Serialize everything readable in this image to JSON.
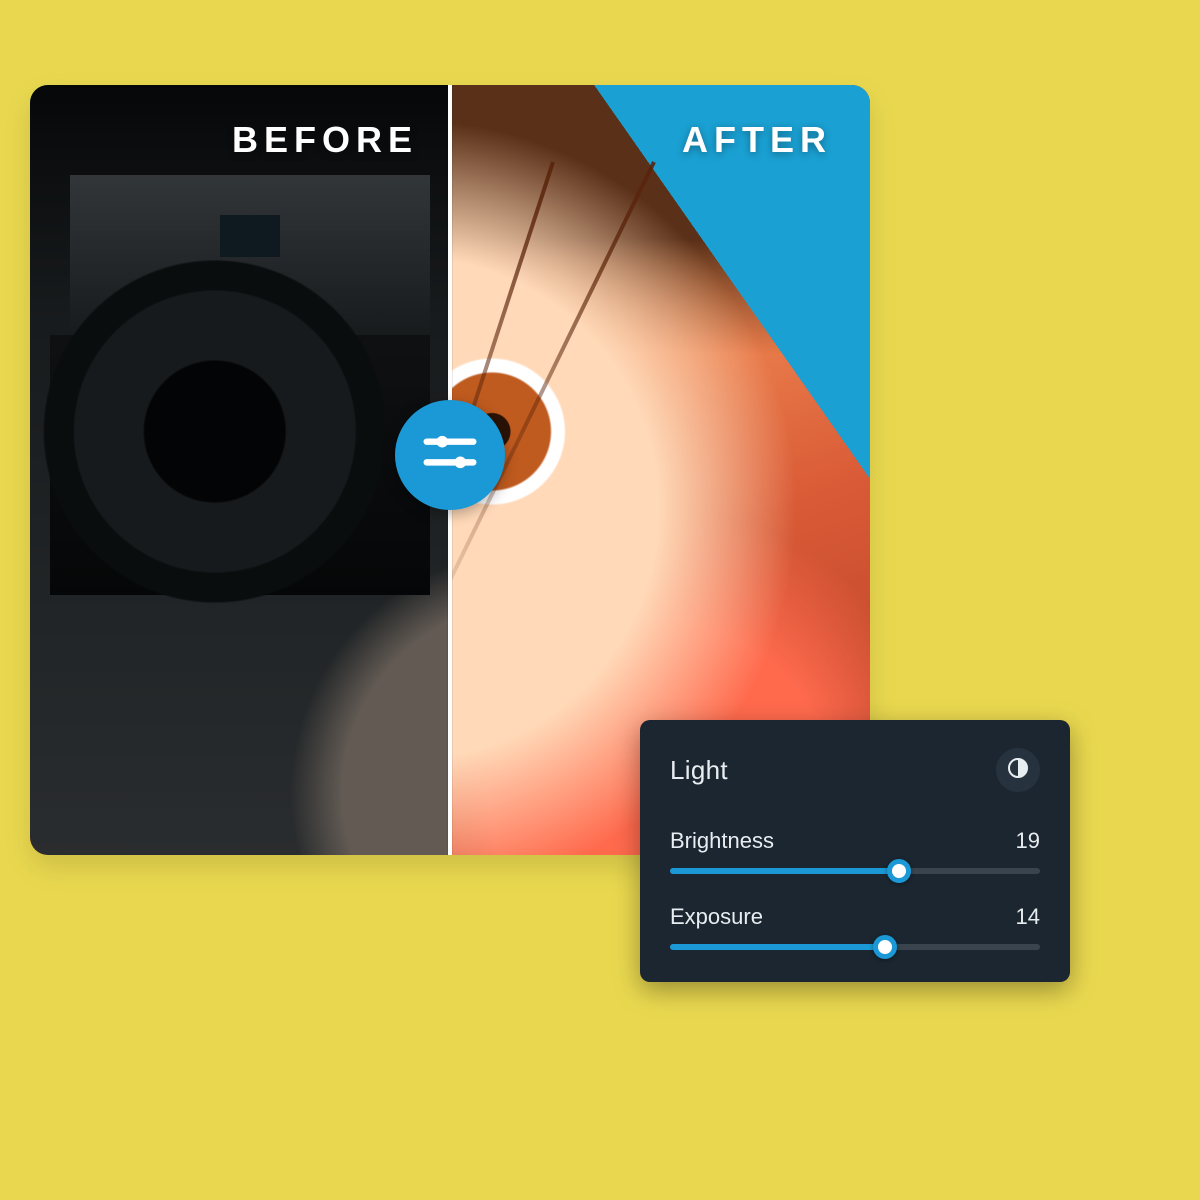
{
  "compare": {
    "before_label": "BEFORE",
    "after_label": "AFTER",
    "handle_icon": "sliders-icon",
    "split_percent": 50
  },
  "panel": {
    "title": "Light",
    "icon": "contrast-icon",
    "controls": [
      {
        "label": "Brightness",
        "value": 19,
        "percent": 62
      },
      {
        "label": "Exposure",
        "value": 14,
        "percent": 58
      }
    ]
  },
  "colors": {
    "page_bg": "#e9d84f",
    "panel_bg": "#1b2630",
    "accent": "#1a99d6",
    "track": "#39444e"
  }
}
